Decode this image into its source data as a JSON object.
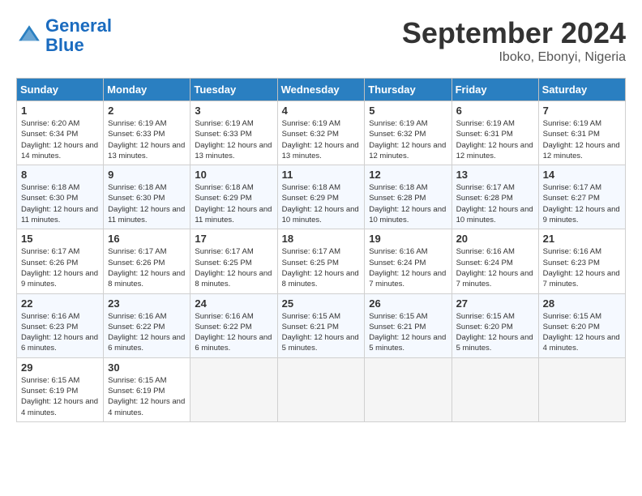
{
  "header": {
    "logo_line1": "General",
    "logo_line2": "Blue",
    "month": "September 2024",
    "location": "Iboko, Ebonyi, Nigeria"
  },
  "days_of_week": [
    "Sunday",
    "Monday",
    "Tuesday",
    "Wednesday",
    "Thursday",
    "Friday",
    "Saturday"
  ],
  "weeks": [
    [
      {
        "day": "1",
        "sunrise": "Sunrise: 6:20 AM",
        "sunset": "Sunset: 6:34 PM",
        "daylight": "Daylight: 12 hours and 14 minutes."
      },
      {
        "day": "2",
        "sunrise": "Sunrise: 6:19 AM",
        "sunset": "Sunset: 6:33 PM",
        "daylight": "Daylight: 12 hours and 13 minutes."
      },
      {
        "day": "3",
        "sunrise": "Sunrise: 6:19 AM",
        "sunset": "Sunset: 6:33 PM",
        "daylight": "Daylight: 12 hours and 13 minutes."
      },
      {
        "day": "4",
        "sunrise": "Sunrise: 6:19 AM",
        "sunset": "Sunset: 6:32 PM",
        "daylight": "Daylight: 12 hours and 13 minutes."
      },
      {
        "day": "5",
        "sunrise": "Sunrise: 6:19 AM",
        "sunset": "Sunset: 6:32 PM",
        "daylight": "Daylight: 12 hours and 12 minutes."
      },
      {
        "day": "6",
        "sunrise": "Sunrise: 6:19 AM",
        "sunset": "Sunset: 6:31 PM",
        "daylight": "Daylight: 12 hours and 12 minutes."
      },
      {
        "day": "7",
        "sunrise": "Sunrise: 6:19 AM",
        "sunset": "Sunset: 6:31 PM",
        "daylight": "Daylight: 12 hours and 12 minutes."
      }
    ],
    [
      {
        "day": "8",
        "sunrise": "Sunrise: 6:18 AM",
        "sunset": "Sunset: 6:30 PM",
        "daylight": "Daylight: 12 hours and 11 minutes."
      },
      {
        "day": "9",
        "sunrise": "Sunrise: 6:18 AM",
        "sunset": "Sunset: 6:30 PM",
        "daylight": "Daylight: 12 hours and 11 minutes."
      },
      {
        "day": "10",
        "sunrise": "Sunrise: 6:18 AM",
        "sunset": "Sunset: 6:29 PM",
        "daylight": "Daylight: 12 hours and 11 minutes."
      },
      {
        "day": "11",
        "sunrise": "Sunrise: 6:18 AM",
        "sunset": "Sunset: 6:29 PM",
        "daylight": "Daylight: 12 hours and 10 minutes."
      },
      {
        "day": "12",
        "sunrise": "Sunrise: 6:18 AM",
        "sunset": "Sunset: 6:28 PM",
        "daylight": "Daylight: 12 hours and 10 minutes."
      },
      {
        "day": "13",
        "sunrise": "Sunrise: 6:17 AM",
        "sunset": "Sunset: 6:28 PM",
        "daylight": "Daylight: 12 hours and 10 minutes."
      },
      {
        "day": "14",
        "sunrise": "Sunrise: 6:17 AM",
        "sunset": "Sunset: 6:27 PM",
        "daylight": "Daylight: 12 hours and 9 minutes."
      }
    ],
    [
      {
        "day": "15",
        "sunrise": "Sunrise: 6:17 AM",
        "sunset": "Sunset: 6:26 PM",
        "daylight": "Daylight: 12 hours and 9 minutes."
      },
      {
        "day": "16",
        "sunrise": "Sunrise: 6:17 AM",
        "sunset": "Sunset: 6:26 PM",
        "daylight": "Daylight: 12 hours and 8 minutes."
      },
      {
        "day": "17",
        "sunrise": "Sunrise: 6:17 AM",
        "sunset": "Sunset: 6:25 PM",
        "daylight": "Daylight: 12 hours and 8 minutes."
      },
      {
        "day": "18",
        "sunrise": "Sunrise: 6:17 AM",
        "sunset": "Sunset: 6:25 PM",
        "daylight": "Daylight: 12 hours and 8 minutes."
      },
      {
        "day": "19",
        "sunrise": "Sunrise: 6:16 AM",
        "sunset": "Sunset: 6:24 PM",
        "daylight": "Daylight: 12 hours and 7 minutes."
      },
      {
        "day": "20",
        "sunrise": "Sunrise: 6:16 AM",
        "sunset": "Sunset: 6:24 PM",
        "daylight": "Daylight: 12 hours and 7 minutes."
      },
      {
        "day": "21",
        "sunrise": "Sunrise: 6:16 AM",
        "sunset": "Sunset: 6:23 PM",
        "daylight": "Daylight: 12 hours and 7 minutes."
      }
    ],
    [
      {
        "day": "22",
        "sunrise": "Sunrise: 6:16 AM",
        "sunset": "Sunset: 6:23 PM",
        "daylight": "Daylight: 12 hours and 6 minutes."
      },
      {
        "day": "23",
        "sunrise": "Sunrise: 6:16 AM",
        "sunset": "Sunset: 6:22 PM",
        "daylight": "Daylight: 12 hours and 6 minutes."
      },
      {
        "day": "24",
        "sunrise": "Sunrise: 6:16 AM",
        "sunset": "Sunset: 6:22 PM",
        "daylight": "Daylight: 12 hours and 6 minutes."
      },
      {
        "day": "25",
        "sunrise": "Sunrise: 6:15 AM",
        "sunset": "Sunset: 6:21 PM",
        "daylight": "Daylight: 12 hours and 5 minutes."
      },
      {
        "day": "26",
        "sunrise": "Sunrise: 6:15 AM",
        "sunset": "Sunset: 6:21 PM",
        "daylight": "Daylight: 12 hours and 5 minutes."
      },
      {
        "day": "27",
        "sunrise": "Sunrise: 6:15 AM",
        "sunset": "Sunset: 6:20 PM",
        "daylight": "Daylight: 12 hours and 5 minutes."
      },
      {
        "day": "28",
        "sunrise": "Sunrise: 6:15 AM",
        "sunset": "Sunset: 6:20 PM",
        "daylight": "Daylight: 12 hours and 4 minutes."
      }
    ],
    [
      {
        "day": "29",
        "sunrise": "Sunrise: 6:15 AM",
        "sunset": "Sunset: 6:19 PM",
        "daylight": "Daylight: 12 hours and 4 minutes."
      },
      {
        "day": "30",
        "sunrise": "Sunrise: 6:15 AM",
        "sunset": "Sunset: 6:19 PM",
        "daylight": "Daylight: 12 hours and 4 minutes."
      },
      {
        "day": "",
        "sunrise": "",
        "sunset": "",
        "daylight": ""
      },
      {
        "day": "",
        "sunrise": "",
        "sunset": "",
        "daylight": ""
      },
      {
        "day": "",
        "sunrise": "",
        "sunset": "",
        "daylight": ""
      },
      {
        "day": "",
        "sunrise": "",
        "sunset": "",
        "daylight": ""
      },
      {
        "day": "",
        "sunrise": "",
        "sunset": "",
        "daylight": ""
      }
    ]
  ]
}
